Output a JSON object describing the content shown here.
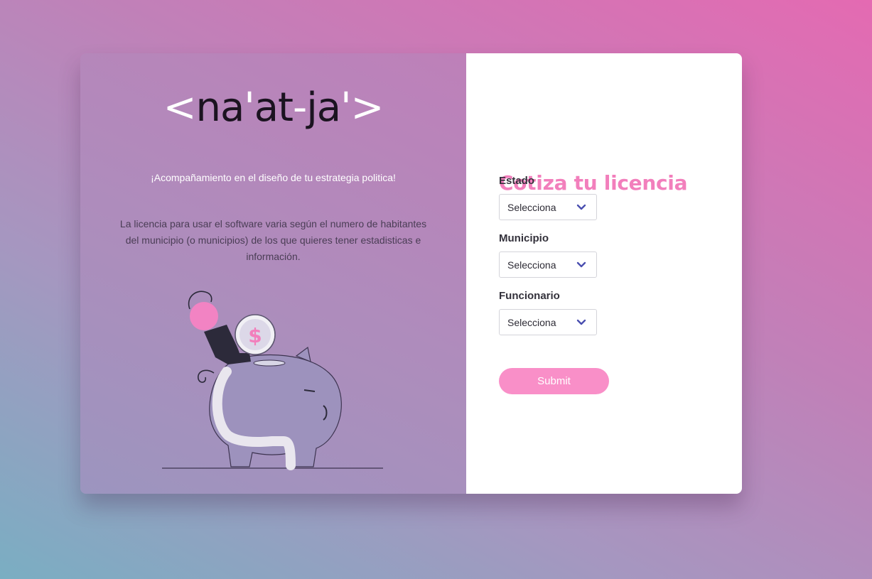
{
  "brand": {
    "logo_parts": [
      "<",
      "na",
      "'",
      "at",
      "-",
      "ja",
      "'",
      ">"
    ]
  },
  "hero": {
    "tagline": "¡Acompañamiento en el diseño de tu estrategia politica!",
    "description": "La licencia para usar el software varia según el numero de habitantes del municipio (o municipios) de los que quieres tener estadisticas e información."
  },
  "illustration": {
    "coin_symbol": "$"
  },
  "form": {
    "title": "Cotiza tu licencia",
    "fields": [
      {
        "label": "Estado",
        "value": "Selecciona"
      },
      {
        "label": "Municipio",
        "value": "Selecciona"
      },
      {
        "label": "Funcionario",
        "value": "Selecciona"
      }
    ],
    "submit_label": "Submit"
  },
  "colors": {
    "accent_pink": "#f27fbc",
    "button_pink": "#f98fc8",
    "chevron_blue": "#4a4fb0",
    "logo_dark": "#1b1320"
  }
}
